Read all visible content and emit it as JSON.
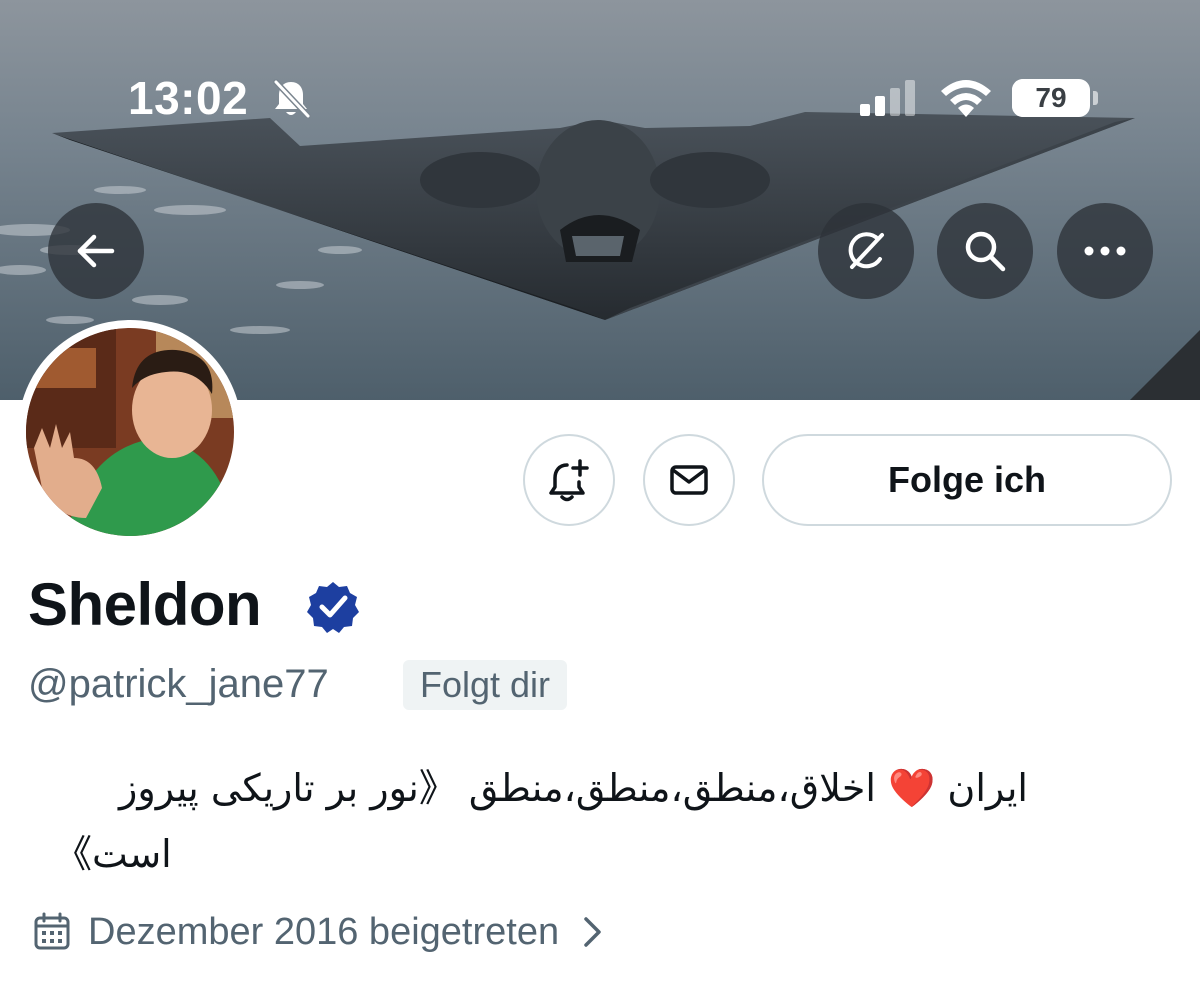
{
  "status_bar": {
    "time": "13:02",
    "battery_percent": "79",
    "battery_level": 0.79,
    "icons": [
      "bell-slash-icon",
      "cellular-signal-icon",
      "wifi-icon",
      "battery-icon"
    ]
  },
  "banner": {
    "buttons": [
      "back-arrow-icon",
      "grok-icon",
      "search-icon",
      "more-icon"
    ]
  },
  "profile": {
    "display_name": "Sheldon",
    "handle": "@patrick_jane77",
    "follows_you_label": "Folgt dir",
    "follow_button_label": "Folge ich",
    "bio_line_1": "ایران ❤️ اخلاق،منطق،منطق،منطق   《نور بر تاریکی پیروز",
    "bio_line_2": "است》",
    "joined_label": "Dezember 2016 beigetreten"
  },
  "colors": {
    "text_primary": "#0f1419",
    "text_secondary": "#536471",
    "border": "#cfd9de",
    "verified_blue": "#1d3fa0",
    "heart_red": "#e0245e"
  }
}
